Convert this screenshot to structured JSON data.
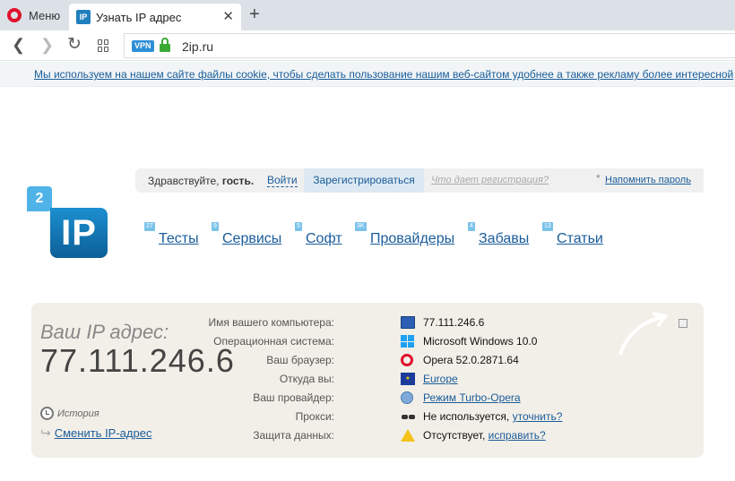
{
  "browser": {
    "menu_label": "Меню",
    "tab_title": "Узнать IP адрес",
    "tab_favicon": "IP",
    "new_tab": "+",
    "close_tab": "✕",
    "vpn_badge": "VPN",
    "url": "2ip.ru",
    "accent": "#e0112b"
  },
  "cookie_notice": "Мы используем на нашем сайте файлы cookie, чтобы сделать пользование нашим веб-сайтом удобнее а также рекламу более интересной",
  "header": {
    "greeting_prefix": "Здравствуйте,",
    "greeting_user": "гость.",
    "login": "Войти",
    "register": "Зарегистрироваться",
    "what_registration": "Что дает регистрация?",
    "star": "*",
    "remind_password": "Напомнить пароль",
    "logo_small": "2",
    "logo_big": "IP"
  },
  "menu": [
    {
      "label": "Тесты",
      "count": "27"
    },
    {
      "label": "Сервисы",
      "count": "9"
    },
    {
      "label": "Софт",
      "count": "5"
    },
    {
      "label": "Провайдеры",
      "count": "3K"
    },
    {
      "label": "Забавы",
      "count": "4"
    },
    {
      "label": "Статьи",
      "count": "13"
    }
  ],
  "info": {
    "ip_label": "Ваш IP адрес:",
    "ip_value": "77.111.246.6",
    "history": "История",
    "change_ip": "Сменить IP-адрес",
    "rows": [
      {
        "label": "Имя вашего компьютера:",
        "value": "77.111.246.6",
        "icon": "computer-icon"
      },
      {
        "label": "Операционная система:",
        "value": "Microsoft Windows 10.0",
        "icon": "windows-icon"
      },
      {
        "label": "Ваш браузер:",
        "value": "Opera 52.0.2871.64",
        "icon": "opera-icon"
      },
      {
        "label": "Откуда вы:",
        "value": "Europe",
        "icon": "eu-flag-icon"
      },
      {
        "label": "Ваш провайдер:",
        "value": "Режим Turbo-Opera",
        "icon": "provider-icon"
      },
      {
        "label": "Прокси:",
        "value": "Не используется,",
        "link": "уточнить?",
        "icon": "glasses-icon"
      },
      {
        "label": "Защита данных:",
        "value": "Отсутствует,",
        "link": "исправить?",
        "icon": "warning-icon"
      }
    ]
  }
}
